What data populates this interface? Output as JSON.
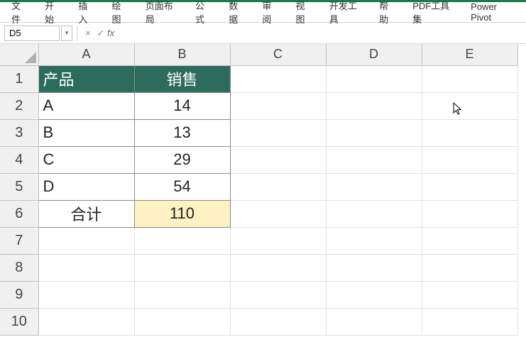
{
  "ribbon": {
    "tabs": [
      "文件",
      "开始",
      "插入",
      "绘图",
      "页面布局",
      "公式",
      "数据",
      "审阅",
      "视图",
      "开发工具",
      "帮助",
      "PDF工具集",
      "Power Pivot"
    ]
  },
  "formula_bar": {
    "name_box": "D5",
    "cancel": "×",
    "confirm": "✓",
    "fx_label": "fx",
    "formula": ""
  },
  "columns": [
    "A",
    "B",
    "C",
    "D",
    "E"
  ],
  "rows": [
    "1",
    "2",
    "3",
    "4",
    "5",
    "6",
    "7",
    "8",
    "9",
    "10"
  ],
  "table": {
    "header": {
      "a": "产品",
      "b": "销售"
    },
    "data": [
      {
        "a": "A",
        "b": "14"
      },
      {
        "a": "B",
        "b": "13"
      },
      {
        "a": "C",
        "b": "29"
      },
      {
        "a": "D",
        "b": "54"
      }
    ],
    "total": {
      "label": "合计",
      "value": "110"
    }
  },
  "colors": {
    "header_bg": "#2d6b5c",
    "total_bg": "#fff2c2",
    "accent": "#1a7a4c"
  }
}
